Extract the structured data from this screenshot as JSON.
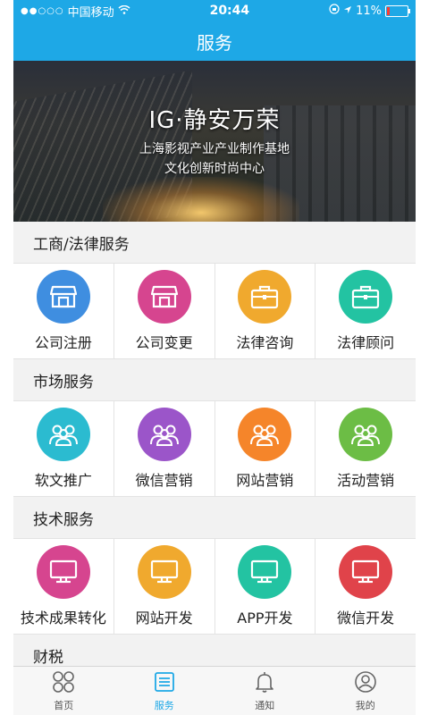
{
  "status": {
    "carrier": "中国移动",
    "time": "20:44",
    "battery": "11%"
  },
  "navbar": {
    "title": "服务"
  },
  "banner": {
    "title": "IG·静安万荣",
    "line1": "上海影视产业产业制作基地",
    "line2": "文化创新时尚中心"
  },
  "sections": [
    {
      "title": "工商/法律服务",
      "items": [
        {
          "label": "公司注册",
          "icon": "store-icon",
          "color": "#3f8ee0"
        },
        {
          "label": "公司变更",
          "icon": "store-icon",
          "color": "#d6458f"
        },
        {
          "label": "法律咨询",
          "icon": "briefcase-icon",
          "color": "#f0a92e"
        },
        {
          "label": "法律顾问",
          "icon": "briefcase-icon",
          "color": "#23c3a2"
        }
      ]
    },
    {
      "title": "市场服务",
      "items": [
        {
          "label": "软文推广",
          "icon": "users-icon",
          "color": "#2bbbd0"
        },
        {
          "label": "微信营销",
          "icon": "users-icon",
          "color": "#9b55c9"
        },
        {
          "label": "网站营销",
          "icon": "users-icon",
          "color": "#f5852a"
        },
        {
          "label": "活动营销",
          "icon": "users-icon",
          "color": "#6cbd45"
        }
      ]
    },
    {
      "title": "技术服务",
      "items": [
        {
          "label": "技术成果转化",
          "icon": "monitor-icon",
          "color": "#d6458f"
        },
        {
          "label": "网站开发",
          "icon": "monitor-icon",
          "color": "#f0a92e"
        },
        {
          "label": "APP开发",
          "icon": "monitor-icon",
          "color": "#23c3a2"
        },
        {
          "label": "微信开发",
          "icon": "monitor-icon",
          "color": "#e0434a"
        }
      ]
    },
    {
      "title": "财税"
    }
  ],
  "tabbar": [
    {
      "label": "首页",
      "icon": "grid-icon"
    },
    {
      "label": "服务",
      "icon": "list-icon",
      "active": true
    },
    {
      "label": "通知",
      "icon": "bell-icon"
    },
    {
      "label": "我的",
      "icon": "user-icon"
    }
  ]
}
